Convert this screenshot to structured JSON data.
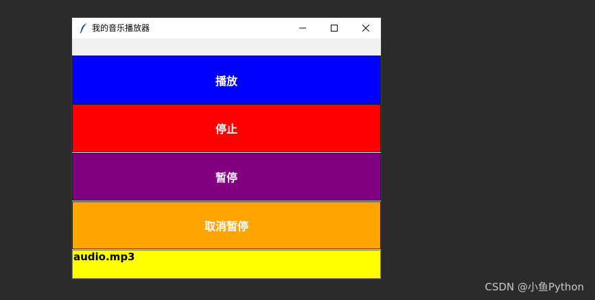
{
  "window": {
    "title": "我的音乐播放器",
    "icon": "feather-icon"
  },
  "buttons": {
    "play": {
      "label": "播放",
      "color": "#0000ff"
    },
    "stop": {
      "label": "停止",
      "color": "#ff0000"
    },
    "pause": {
      "label": "暂停",
      "color": "#800080"
    },
    "resume": {
      "label": "取消暂停",
      "color": "#ffa500"
    }
  },
  "status": {
    "text": "audio.mp3",
    "color": "#ffff00"
  },
  "watermark": "CSDN @小鱼Python"
}
